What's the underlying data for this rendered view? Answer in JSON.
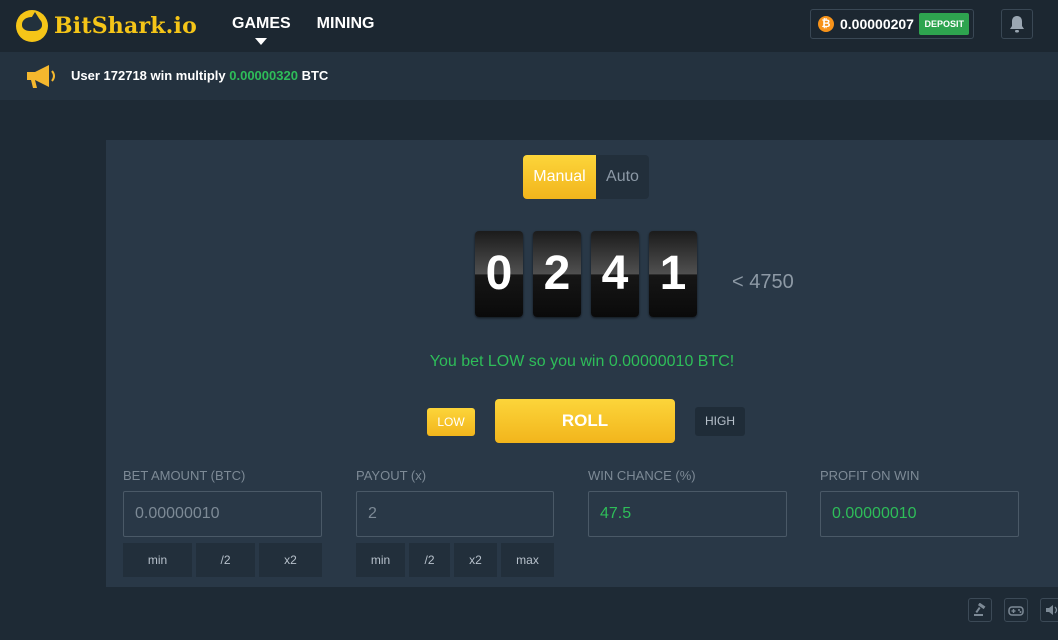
{
  "app": {
    "logo_text": "BitShark.io"
  },
  "nav": {
    "items": [
      {
        "label": "GAMES",
        "active": true
      },
      {
        "label": "MINING",
        "active": false
      }
    ]
  },
  "wallet": {
    "balance": "0.00000207",
    "deposit_label": "DEPOSIT",
    "currency_icon": "bitcoin-icon"
  },
  "notifications": {
    "icon": "bell-icon"
  },
  "announcement": {
    "icon": "megaphone-icon",
    "prefix": "User 172718 win multiply",
    "amount": "0.00000320",
    "currency": "BTC"
  },
  "game": {
    "modes": [
      {
        "label": "Manual",
        "active": true
      },
      {
        "label": "Auto",
        "active": false
      }
    ],
    "digits": [
      "0",
      "2",
      "4",
      "1"
    ],
    "target": "< 4750",
    "result_message": "You bet LOW so you win 0.00000010 BTC!",
    "low_label": "LOW",
    "roll_label": "ROLL",
    "high_label": "HIGH"
  },
  "fields": {
    "bet_amount": {
      "label": "BET AMOUNT (BTC)",
      "placeholder": "0.00000010",
      "buttons": [
        "min",
        "/2",
        "x2"
      ]
    },
    "payout": {
      "label": "PAYOUT (x)",
      "placeholder": "2",
      "buttons": [
        "min",
        "/2",
        "x2",
        "max"
      ]
    },
    "win_chance": {
      "label": "WIN CHANCE (%)",
      "value": "47.5"
    },
    "profit_on_win": {
      "label": "PROFIT ON WIN",
      "value": "0.00000010"
    }
  },
  "footer": {
    "icons": [
      "fairness-icon",
      "gamepad-icon",
      "sound-icon"
    ]
  },
  "colors": {
    "accent": "#f5c518",
    "win": "#2ebd59",
    "background": "#1e2a35",
    "panel": "#293847"
  }
}
